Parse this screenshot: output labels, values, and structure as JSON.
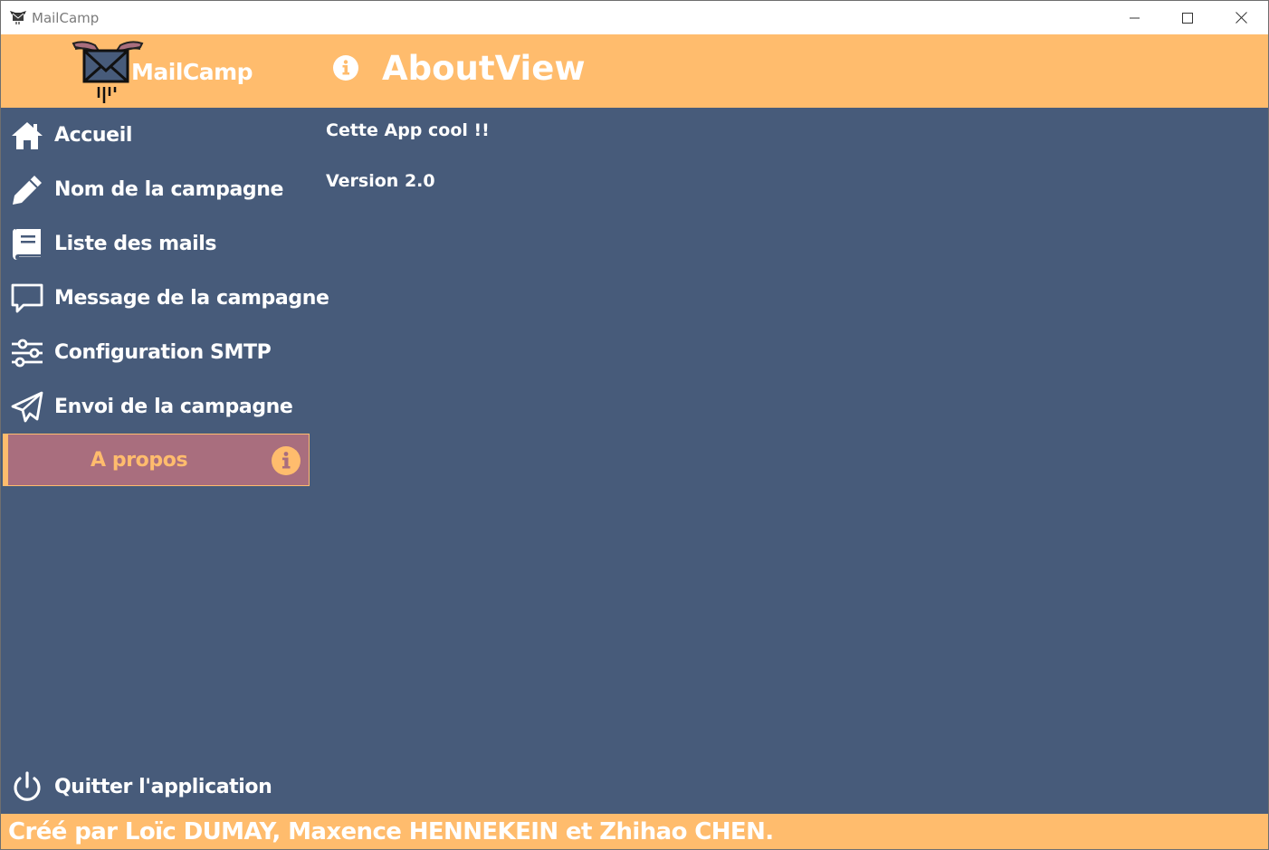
{
  "window": {
    "title": "MailCamp",
    "controls": [
      "minimize",
      "maximize",
      "close"
    ]
  },
  "header": {
    "brand": "MailCamp",
    "view_title": "AboutView",
    "view_icon": "info-circle-icon"
  },
  "sidebar": {
    "items": [
      {
        "label": "Accueil",
        "icon": "home-icon"
      },
      {
        "label": "Nom de la campagne",
        "icon": "pencil-icon"
      },
      {
        "label": "Liste des mails",
        "icon": "book-icon"
      },
      {
        "label": "Message de la campagne",
        "icon": "chat-bubble-icon"
      },
      {
        "label": "Configuration SMTP",
        "icon": "sliders-icon"
      },
      {
        "label": "Envoi de la campagne",
        "icon": "paper-plane-icon"
      },
      {
        "label": "A propos",
        "icon": "info-circle-icon",
        "active": true
      }
    ],
    "quit": {
      "label": "Quitter l'application",
      "icon": "power-icon"
    }
  },
  "content": {
    "lines": [
      "Cette App cool !!",
      "Version 2.0"
    ]
  },
  "footer": {
    "credits": "Créé par Loïc DUMAY, Maxence HENNEKEIN et Zhihao CHEN."
  },
  "colors": {
    "accent": "#ffbc6d",
    "background": "#475b7a",
    "active_item": "#a96e7e",
    "text": "#ffffff"
  }
}
